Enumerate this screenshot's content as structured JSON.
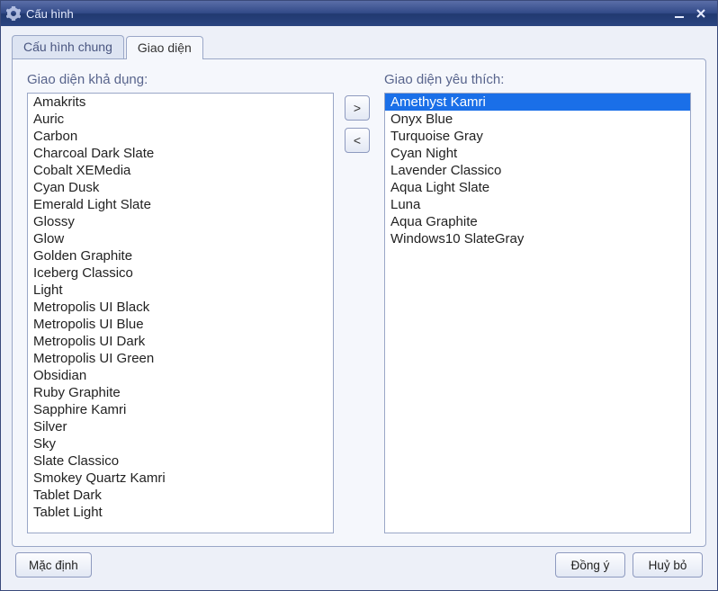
{
  "window": {
    "title": "Cấu hình"
  },
  "tabs": {
    "general": "Cấu hình chung",
    "appearance": "Giao diện",
    "active": "appearance"
  },
  "labels": {
    "available": "Giao diện khả dụng:",
    "favorite": "Giao diện yêu thích:"
  },
  "buttons": {
    "move_right": ">",
    "move_left": "<",
    "default": "Mặc định",
    "ok": "Đồng ý",
    "cancel": "Huỷ bỏ"
  },
  "available_list": [
    "Amakrits",
    "Auric",
    "Carbon",
    "Charcoal Dark Slate",
    "Cobalt XEMedia",
    "Cyan Dusk",
    "Emerald Light Slate",
    "Glossy",
    "Glow",
    "Golden Graphite",
    "Iceberg Classico",
    "Light",
    "Metropolis UI Black",
    "Metropolis UI Blue",
    "Metropolis UI Dark",
    "Metropolis UI Green",
    "Obsidian",
    "Ruby Graphite",
    "Sapphire Kamri",
    "Silver",
    "Sky",
    "Slate Classico",
    "Smokey Quartz Kamri",
    "Tablet Dark",
    "Tablet Light"
  ],
  "favorite_list": [
    "Amethyst Kamri",
    "Onyx Blue",
    "Turquoise Gray",
    "Cyan Night",
    "Lavender Classico",
    "Aqua Light Slate",
    "Luna",
    "Aqua Graphite",
    "Windows10 SlateGray"
  ],
  "favorite_selected_index": 0
}
